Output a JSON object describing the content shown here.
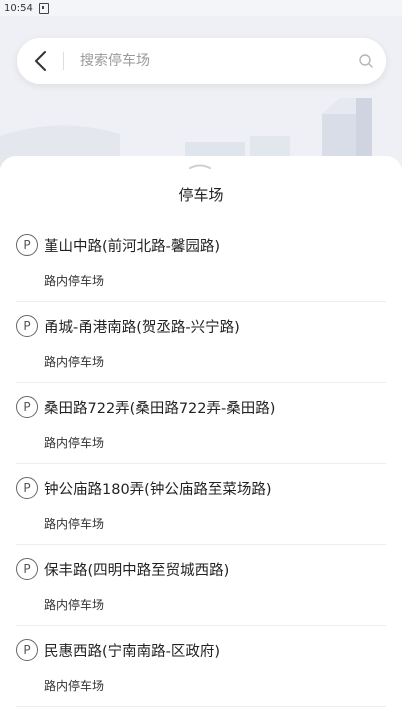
{
  "status_bar": {
    "time": "10:54"
  },
  "search": {
    "placeholder": "搜索停车场",
    "value": ""
  },
  "sheet": {
    "title": "停车场"
  },
  "parking_list": [
    {
      "name": "堇山中路(前河北路-馨园路)",
      "type": "路内停车场"
    },
    {
      "name": "甬城-甬港南路(贺丞路-兴宁路)",
      "type": "路内停车场"
    },
    {
      "name": "桑田路722弄(桑田路722弄-桑田路)",
      "type": "路内停车场"
    },
    {
      "name": "钟公庙路180弄(钟公庙路至菜场路)",
      "type": "路内停车场"
    },
    {
      "name": "保丰路(四明中路至贸城西路)",
      "type": "路内停车场"
    },
    {
      "name": "民惠西路(宁南南路-区政府)",
      "type": "路内停车场"
    }
  ],
  "icons": {
    "parking": "P"
  },
  "colors": {
    "background": "#eef0f5",
    "sheet": "#ffffff",
    "illustration": "#dde1ea"
  }
}
